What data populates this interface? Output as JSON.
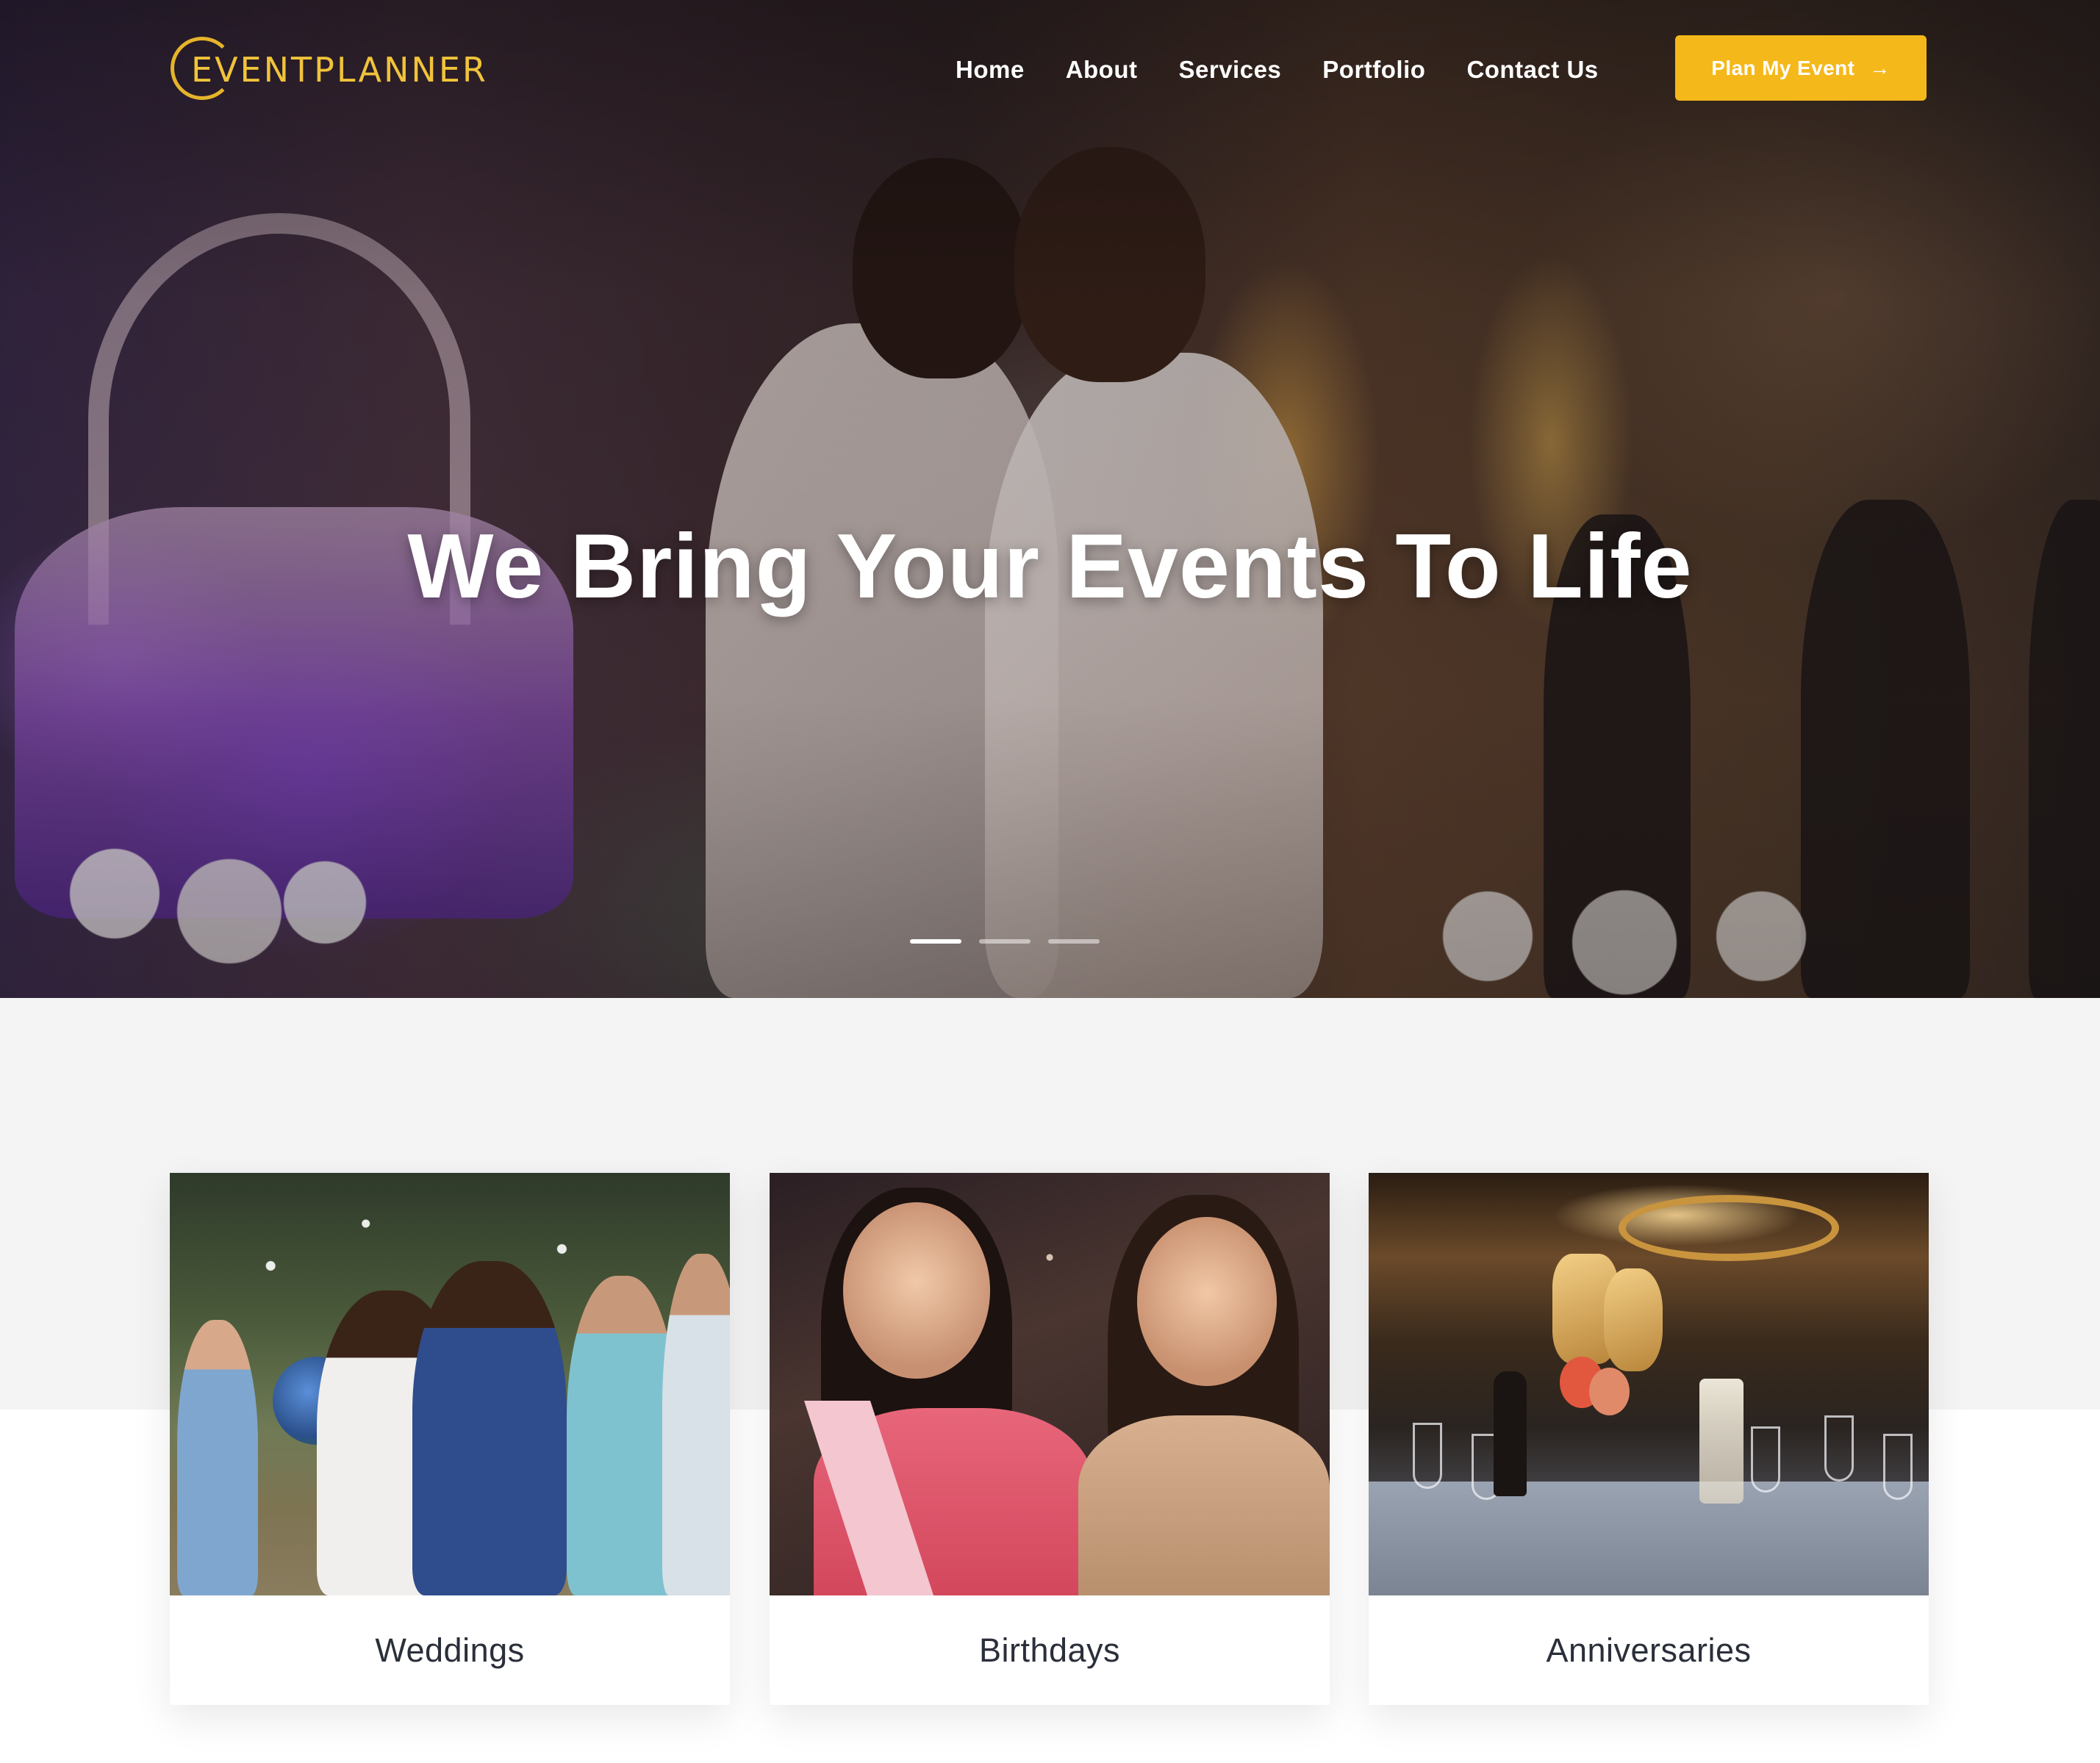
{
  "brand": {
    "logo_text": "EVENTPLANNER",
    "accent_color": "#f5b81b",
    "logo_color": "#f0c33b"
  },
  "nav": {
    "links": [
      "Home",
      "About",
      "Services",
      "Portfolio",
      "Contact Us"
    ],
    "cta_label": "Plan My Event",
    "cta_icon": "arrow-right-icon"
  },
  "hero": {
    "headline": "We Bring Your Events To Life",
    "slide_count": 3,
    "active_slide": 0
  },
  "services": {
    "cards": [
      {
        "title": "Weddings"
      },
      {
        "title": "Birthdays"
      },
      {
        "title": "Anniversaries"
      }
    ]
  }
}
